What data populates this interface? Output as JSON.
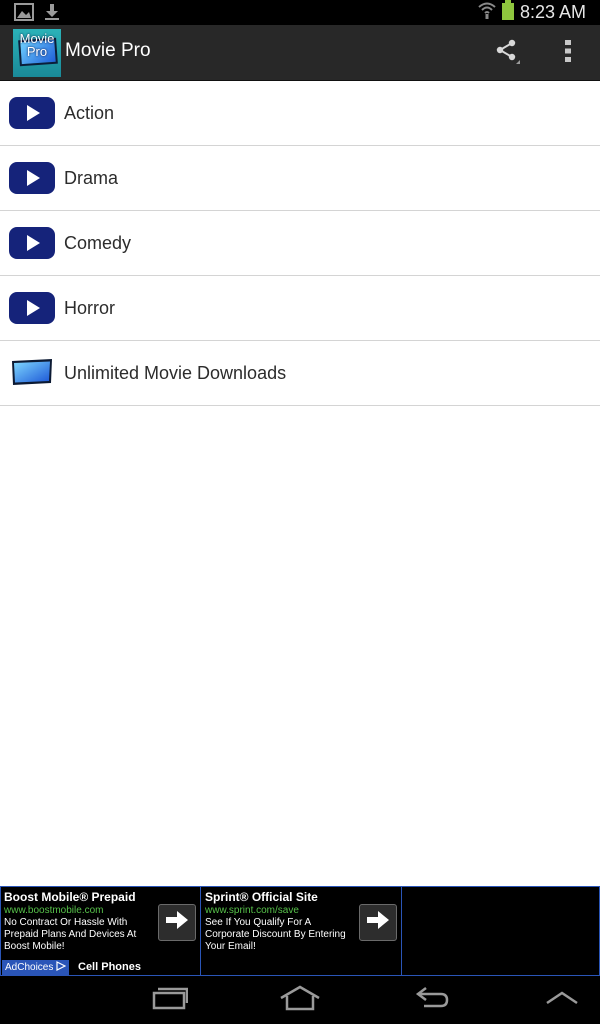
{
  "status_bar": {
    "time": "8:23 AM",
    "icons": [
      "gallery-icon",
      "download-icon",
      "wifi-icon",
      "battery-icon"
    ]
  },
  "action_bar": {
    "icon_text_line1": "Movie",
    "icon_text_line2": "Pro",
    "title": "Movie Pro",
    "actions": [
      "share-icon",
      "overflow-menu-icon"
    ]
  },
  "list": {
    "items": [
      {
        "label": "Action",
        "icon": "play-icon"
      },
      {
        "label": "Drama",
        "icon": "play-icon"
      },
      {
        "label": "Comedy",
        "icon": "play-icon"
      },
      {
        "label": "Horror",
        "icon": "play-icon"
      },
      {
        "label": "Unlimited Movie Downloads",
        "icon": "tv-icon"
      }
    ]
  },
  "ads": [
    {
      "title": "Boost Mobile® Prepaid",
      "url": "www.boostmobile.com",
      "description": "No Contract Or Hassle With Prepaid Plans And Devices At Boost Mobile!"
    },
    {
      "title": "Sprint® Official Site",
      "url": "www.sprint.com/save",
      "description": "See If You Qualify For A Corporate Discount By Entering Your Email!"
    }
  ],
  "ad_footer": {
    "adchoices_label": "AdChoices",
    "category": "Cell Phones"
  },
  "nav_bar": {
    "buttons": [
      "recent-apps-icon",
      "home-icon",
      "back-icon",
      "menu-up-icon"
    ]
  },
  "colors": {
    "action_bar": "#282828",
    "play_icon": "#15237a",
    "ad_border": "#2a55b8",
    "ad_url": "#57c24a"
  }
}
